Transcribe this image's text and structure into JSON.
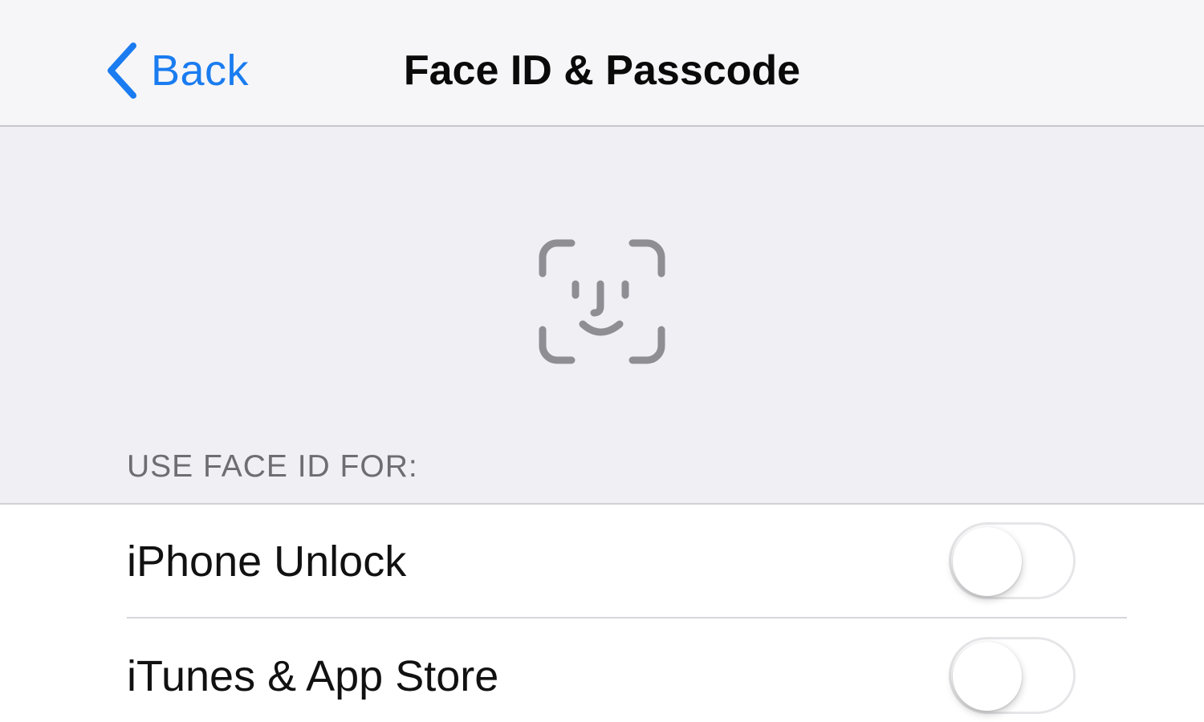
{
  "nav": {
    "back_label": "Back",
    "title": "Face ID & Passcode"
  },
  "header": {
    "icon": "face-id-icon",
    "section_title": "USE FACE ID FOR:"
  },
  "settings": [
    {
      "label": "iPhone Unlock",
      "enabled": false
    },
    {
      "label": "iTunes & App Store",
      "enabled": false
    }
  ],
  "colors": {
    "accent": "#1a7cf0",
    "background": "#f0eff4",
    "icon_gray": "#8e8e93"
  }
}
